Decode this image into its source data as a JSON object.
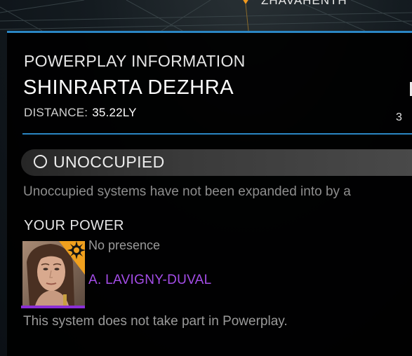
{
  "map": {
    "label": "ZHAVAHENTH",
    "marker_color": "#f19a1e"
  },
  "panel": {
    "subheading": "POWERPLAY INFORMATION",
    "system_name": "SHINRARTA DEZHRA",
    "distance_label": "DISTANCE:",
    "distance_value": "35.22LY",
    "clipped_right_value": "3",
    "accent_color": "#2a86c4",
    "status": {
      "icon": "empty-circle-icon",
      "label": "UNOCCUPIED",
      "description": "Unoccupied systems have not been expanded into by a"
    },
    "your_power": {
      "heading": "YOUR POWER",
      "presence": "No presence",
      "power_name": "A. LAVIGNY-DUVAL",
      "power_color": "#a44de8",
      "badge_icon": "sun-emblem-icon",
      "badge_color": "#f0a01e",
      "note": "This system does not take part in Powerplay."
    }
  }
}
